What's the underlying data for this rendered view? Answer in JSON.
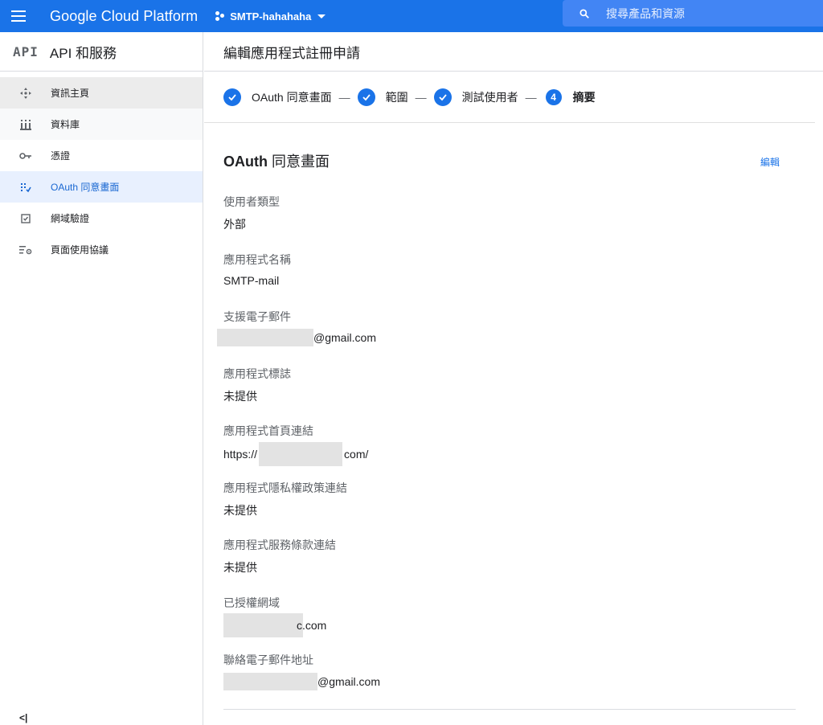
{
  "topbar": {
    "brand": "Google Cloud Platform",
    "project": "SMTP-hahahaha",
    "search_placeholder": "搜尋產品和資源",
    "color": "#1a73e8"
  },
  "sidebar": {
    "logo": "API",
    "title": "API 和服務",
    "items": [
      {
        "label": "資訊主頁",
        "icon": "dashboard-icon"
      },
      {
        "label": "資料庫",
        "icon": "library-icon"
      },
      {
        "label": "憑證",
        "icon": "key-icon"
      },
      {
        "label": "OAuth 同意畫面",
        "icon": "consent-icon",
        "active": true
      },
      {
        "label": "網域驗證",
        "icon": "checkbox-icon"
      },
      {
        "label": "頁面使用協議",
        "icon": "settings-list-icon"
      }
    ],
    "collapse": "<|"
  },
  "page": {
    "title": "編輯應用程式註冊申請"
  },
  "stepper": {
    "steps": [
      "OAuth 同意畫面",
      "範圍",
      "測試使用者"
    ],
    "separator": "—",
    "current_number": "4",
    "current_label": "摘要"
  },
  "section": {
    "title_en": "OAuth",
    "title_zh": "同意畫面",
    "edit": "編輯"
  },
  "fields": [
    {
      "label": "使用者類型",
      "value": "外部"
    },
    {
      "label": "應用程式名稱",
      "value": "SMTP-mail"
    },
    {
      "label": "支援電子郵件",
      "suffix": "@gmail.com"
    },
    {
      "label": "應用程式標誌",
      "value": "未提供"
    },
    {
      "label": "應用程式首頁連結",
      "prefix": "https://",
      "suffix": "com/"
    },
    {
      "label": "應用程式隱私權政策連結",
      "value": "未提供"
    },
    {
      "label": "應用程式服務條款連結",
      "value": "未提供"
    },
    {
      "label": "已授權網域",
      "suffix": "c.com"
    },
    {
      "label": "聯絡電子郵件地址",
      "suffix": "@gmail.com"
    }
  ]
}
